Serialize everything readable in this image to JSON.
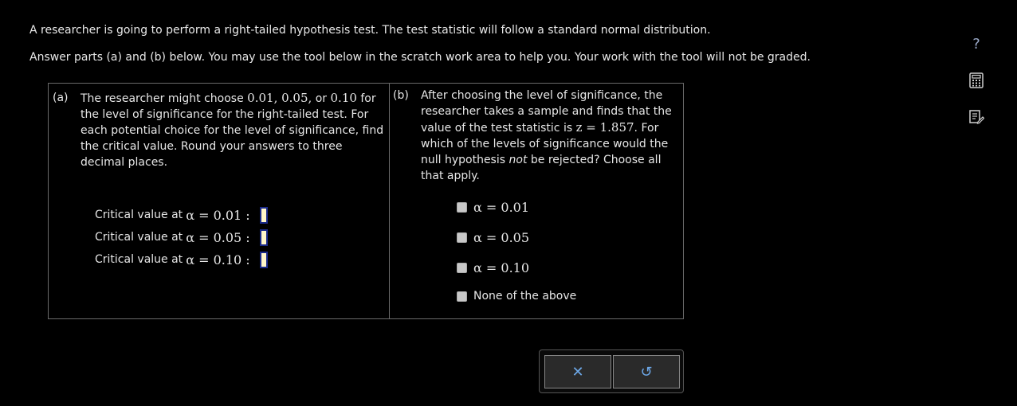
{
  "intro": {
    "line1": "A researcher is going to perform a right-tailed hypothesis test. The test statistic will follow a standard normal distribution.",
    "line2": "Answer parts (a) and (b) below. You may use the tool below in the scratch work area to help you. Your work with the tool will not be graded."
  },
  "part_a": {
    "tag": "(a)",
    "text_pre": "The researcher might choose ",
    "alphas": "0.01, 0.05,",
    "or_word": " or ",
    "alpha_last": "0.10",
    "text_post": " for the level of significance for the right-tailed test. For each potential choice for the level of significance, find the critical value. Round your answers to three decimal places.",
    "rows": [
      {
        "label": "Critical value at ",
        "math": "α = 0.01 :",
        "value": ""
      },
      {
        "label": "Critical value at ",
        "math": "α = 0.05 :",
        "value": ""
      },
      {
        "label": "Critical value at ",
        "math": "α = 0.10 :",
        "value": ""
      }
    ]
  },
  "part_b": {
    "tag": "(b)",
    "text_1": "After choosing the level of significance, the researcher takes a sample and finds that the value of the test statistic is ",
    "stat": "z = 1.857",
    "text_2": ". For which of the levels of significance would the null hypothesis ",
    "not_word": "not",
    "text_3": " be rejected? Choose all that apply.",
    "options": [
      {
        "label": "α = 0.01",
        "math": true,
        "checked": false
      },
      {
        "label": "α = 0.05",
        "math": true,
        "checked": false
      },
      {
        "label": "α = 0.10",
        "math": true,
        "checked": false
      },
      {
        "label": "None of the above",
        "math": false,
        "checked": false
      }
    ]
  },
  "buttons": {
    "clear_icon": "close-icon",
    "clear_glyph": "✕",
    "undo_icon": "undo-icon",
    "undo_glyph": "↺"
  },
  "sidebar": {
    "help_glyph": "?",
    "help_icon": "help-icon",
    "calculator_icon": "calculator-icon",
    "notes_icon": "notes-icon"
  },
  "colors": {
    "background": "#000000",
    "input_fill": "#fff6c8",
    "input_border": "#1a2a8a",
    "button_icon": "#6da8e8"
  }
}
